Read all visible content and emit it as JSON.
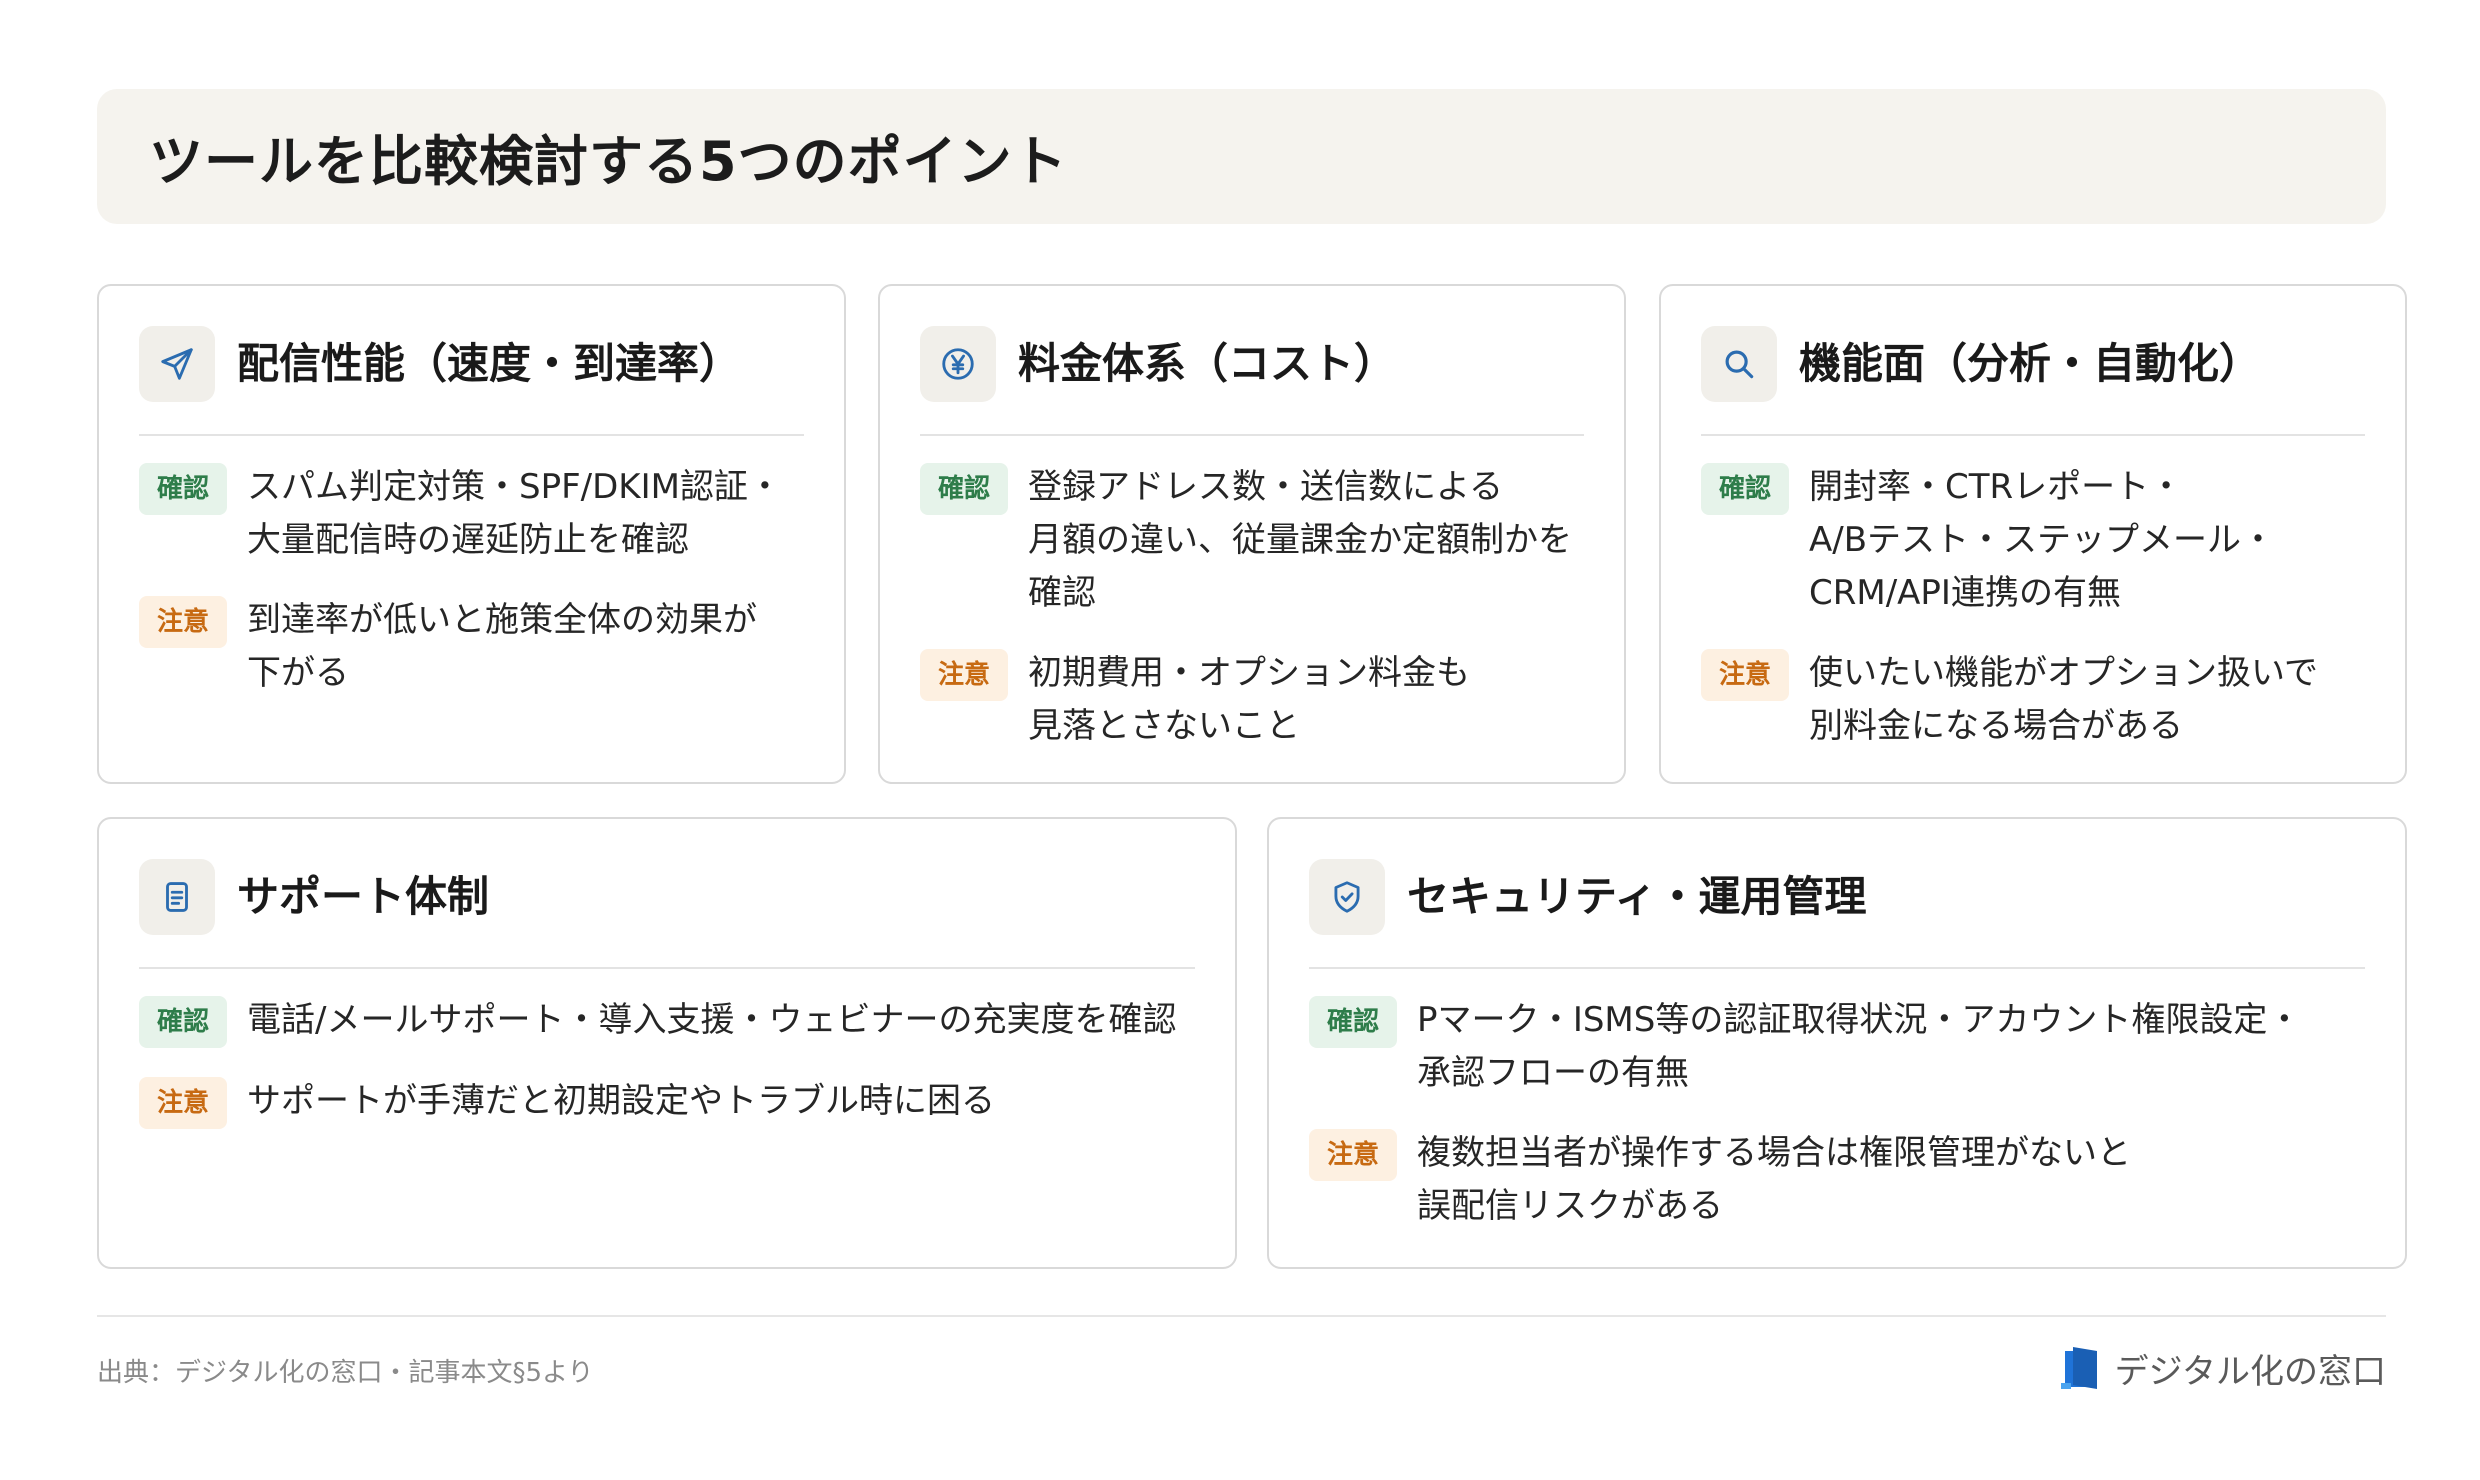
{
  "page": {
    "title": "ツールを比較検討する5つのポイント"
  },
  "labels": {
    "check": "確認",
    "caution": "注意"
  },
  "colors": {
    "icon_blue": "#2b6cb0",
    "check_badge_bg": "#e6f3ea",
    "check_badge_text": "#2e7d4a",
    "caution_badge_bg": "#fdf0e1",
    "caution_badge_text": "#c76a12",
    "brand_blue": "#1f73d8"
  },
  "cards": [
    {
      "icon": "send-icon",
      "title": "配信性能（速度・到達率）",
      "check": "スパム判定対策・SPF/DKIM認証・\n大量配信時の遅延防止を確認",
      "caution": "到達率が低いと施策全体の効果が\n下がる"
    },
    {
      "icon": "yen-coin-icon",
      "title": "料金体系（コスト）",
      "check": "登録アドレス数・送信数による\n月額の違い、従量課金か定額制かを\n確認",
      "caution": "初期費用・オプション料金も\n見落とさないこと"
    },
    {
      "icon": "search-icon",
      "title": "機能面（分析・自動化）",
      "check": "開封率・CTRレポート・\nA/Bテスト・ステップメール・\nCRM/API連携の有無",
      "caution": "使いたい機能がオプション扱いで\n別料金になる場合がある"
    },
    {
      "icon": "document-icon",
      "title": "サポート体制",
      "check": "電話/メールサポート・導入支援・ウェビナーの充実度を確認",
      "caution": "サポートが手薄だと初期設定やトラブル時に困る"
    },
    {
      "icon": "shield-check-icon",
      "title": "セキュリティ・運用管理",
      "check": "Pマーク・ISMS等の認証取得状況・アカウント権限設定・\n承認フローの有無",
      "caution": "複数担当者が操作する場合は権限管理がないと\n誤配信リスクがある"
    }
  ],
  "footer": {
    "source": "出典：デジタル化の窓口・記事本文§5より",
    "brand": "デジタル化の窓口",
    "brand_icon": "door-logo-icon"
  }
}
